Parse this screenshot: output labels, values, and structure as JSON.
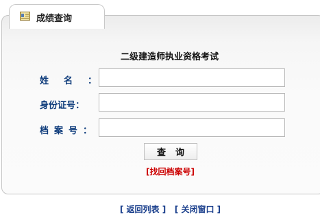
{
  "tab": {
    "title": "成绩查询"
  },
  "form": {
    "title": "二级建造师执业资格考试",
    "name_label": "姓名：",
    "id_label": "身份证号：",
    "archive_label": "档案号：",
    "name_value": "",
    "id_value": "",
    "archive_value": "",
    "query_button": "查询",
    "recover_link": "[找回档案号]"
  },
  "footer": {
    "back_link": "[ 返回列表 ]",
    "close_link": "[ 关闭窗口 ]"
  },
  "colors": {
    "label": "#0c3a7a",
    "recover": "#cc0000",
    "footer": "#1a3f8c"
  },
  "icons": {
    "tab_icon": "id-card-icon"
  }
}
